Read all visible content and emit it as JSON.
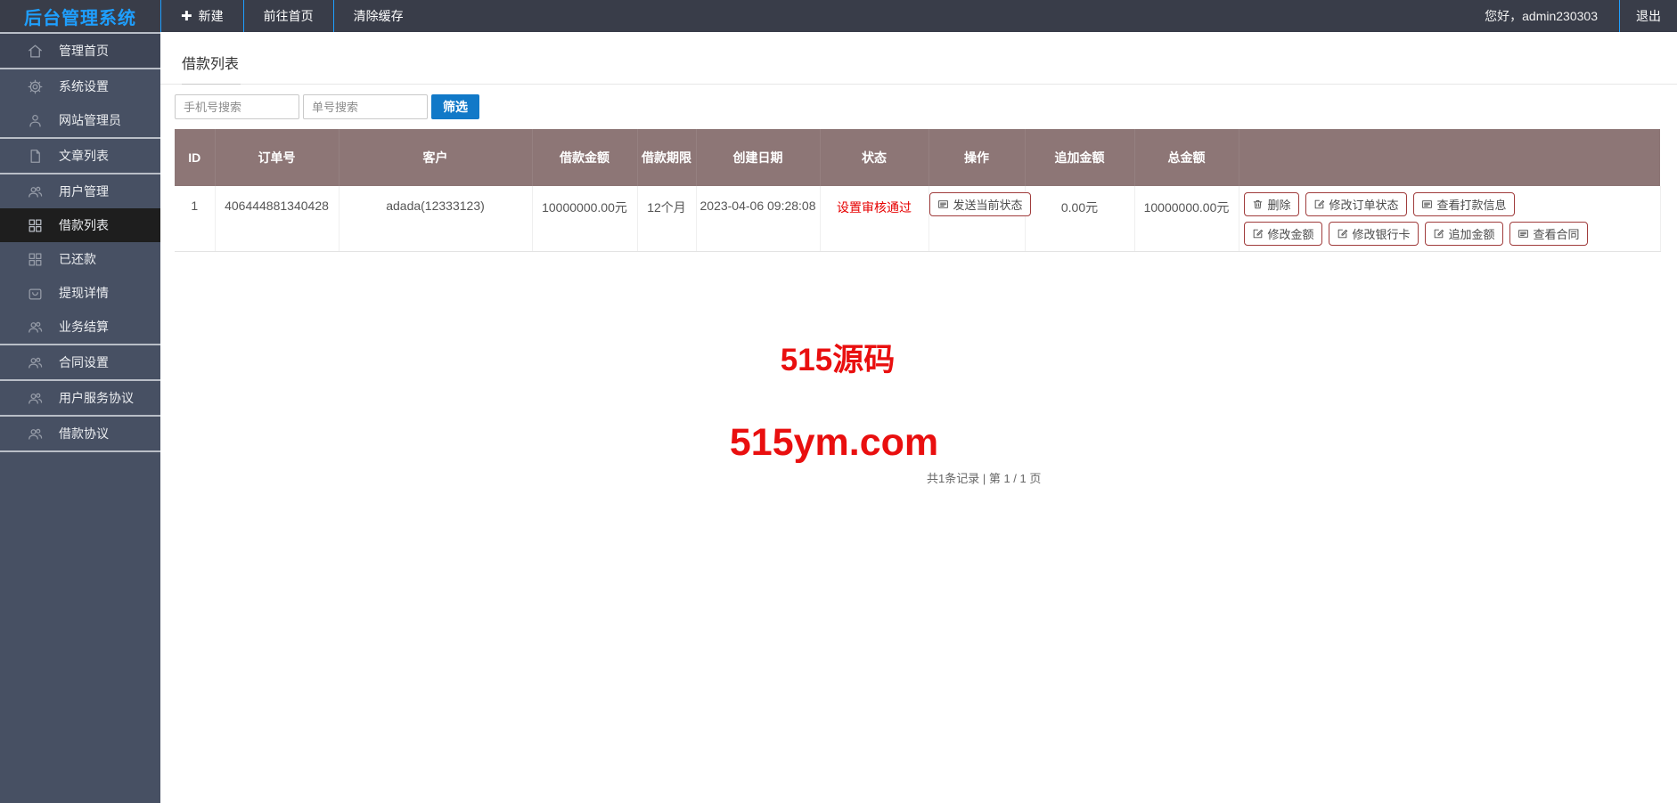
{
  "topbar": {
    "logo": "后台管理系统",
    "nav": [
      {
        "label": "新建",
        "icon": "plus-icon"
      },
      {
        "label": "前往首页",
        "icon": null
      },
      {
        "label": "清除缓存",
        "icon": null
      }
    ],
    "greeting": "您好，admin230303",
    "logout": "退出"
  },
  "icons": {
    "plus": "✚"
  },
  "sidebar": {
    "items": [
      {
        "label": "管理首页",
        "icon": "home-icon"
      },
      {
        "label": "系统设置",
        "icon": "gear-icon"
      },
      {
        "label": "网站管理员",
        "icon": "user-icon"
      },
      {
        "label": "文章列表",
        "icon": "file-icon"
      },
      {
        "label": "用户管理",
        "icon": "users-icon"
      },
      {
        "label": "借款列表",
        "icon": "grid-icon",
        "active": true
      },
      {
        "label": "已还款",
        "icon": "grid-icon"
      },
      {
        "label": "提现详情",
        "icon": "bag-icon"
      },
      {
        "label": "业务结算",
        "icon": "users-icon"
      },
      {
        "label": "合同设置",
        "icon": "users-icon"
      },
      {
        "label": "用户服务协议",
        "icon": "users-icon"
      },
      {
        "label": "借款协议",
        "icon": "users-icon"
      }
    ]
  },
  "main": {
    "title": "借款列表",
    "search": {
      "phone_placeholder": "手机号搜索",
      "order_placeholder": "单号搜索",
      "filter_label": "筛选"
    },
    "table": {
      "headers": [
        "ID",
        "订单号",
        "客户",
        "借款金额",
        "借款期限",
        "创建日期",
        "状态",
        "操作",
        "追加金额",
        "总金额",
        ""
      ],
      "row": {
        "id": "1",
        "order_no": "406444881340428",
        "customer": "adada(12333123)",
        "loan_amount": "10000000.00元",
        "loan_term": "12个月",
        "created_at": "2023-04-06 09:28:08",
        "status": "设置审核通过",
        "operation_label": "发送当前状态",
        "additional_amount": "0.00元",
        "total_amount": "10000000.00元",
        "actions_row1": [
          "删除",
          "修改订单状态",
          "查看打款信息"
        ],
        "actions_row2": [
          "修改金额",
          "修改银行卡",
          "追加金额",
          "查看合同"
        ]
      }
    },
    "watermark": {
      "line1": "515源码",
      "line2": "515ym.com"
    },
    "pagination": "共1条记录 | 第 1 / 1 页"
  },
  "colors": {
    "topbar_bg": "#393D49",
    "accent_blue": "#1E9FFF",
    "filter_button_blue": "#1179C8",
    "sidebar_bg": "#475063",
    "sidebar_active_bg": "#1E1E1E",
    "table_header_mauve": "#8D7676",
    "status_red": "#E60000",
    "action_button_border": "#A03C3C",
    "watermark_red": "#E90F0F"
  }
}
